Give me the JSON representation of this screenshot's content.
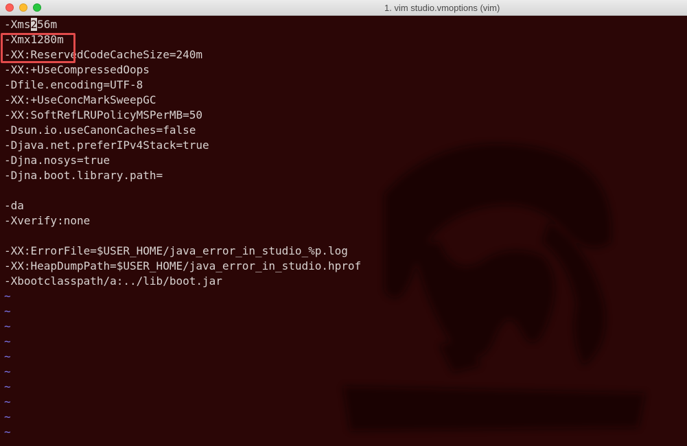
{
  "window": {
    "title": "1. vim studio.vmoptions (vim)"
  },
  "editor": {
    "cursor_line_prefix": "-Xms",
    "cursor_char": "2",
    "cursor_line_suffix": "56m",
    "lines": [
      "-Xmx1280m",
      "-XX:ReservedCodeCacheSize=240m",
      "-XX:+UseCompressedOops",
      "-Dfile.encoding=UTF-8",
      "-XX:+UseConcMarkSweepGC",
      "-XX:SoftRefLRUPolicyMSPerMB=50",
      "-Dsun.io.useCanonCaches=false",
      "-Djava.net.preferIPv4Stack=true",
      "-Djna.nosys=true",
      "-Djna.boot.library.path=",
      "",
      "-da",
      "-Xverify:none",
      "",
      "-XX:ErrorFile=$USER_HOME/java_error_in_studio_%p.log",
      "-XX:HeapDumpPath=$USER_HOME/java_error_in_studio.hprof",
      "-Xbootclasspath/a:../lib/boot.jar"
    ],
    "tilde": "~"
  },
  "colors": {
    "background": "#2b0606",
    "text": "#d9d3d1",
    "tilde": "#7a73e8",
    "highlight": "#e24b4b"
  }
}
